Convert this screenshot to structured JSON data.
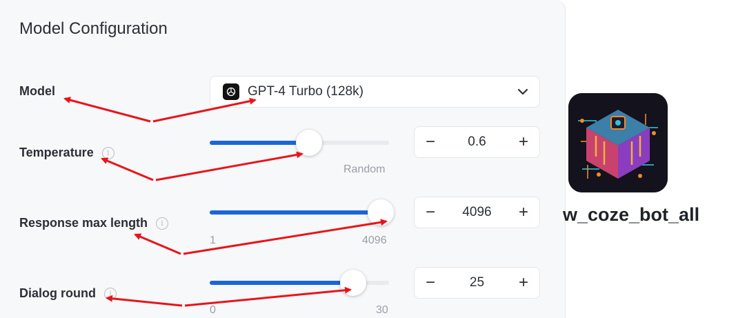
{
  "panel": {
    "title": "Model Configuration"
  },
  "model": {
    "label": "Model",
    "selected": "GPT-4 Turbo (128k)"
  },
  "temperature": {
    "label": "Temperature",
    "value": "0.6",
    "fraction": 0.56,
    "end_label": "Random"
  },
  "response_max_length": {
    "label": "Response max length",
    "value": "4096",
    "fraction": 1.0,
    "min_label": "1",
    "max_label": "4096"
  },
  "dialog_round": {
    "label": "Dialog round",
    "value": "25",
    "fraction": 0.83,
    "min_label": "0",
    "max_label": "30"
  },
  "stepper": {
    "minus": "−",
    "plus": "+"
  },
  "info_glyph": "i",
  "bot": {
    "name": "w_coze_bot_all"
  },
  "colors": {
    "accent": "#1a66d6",
    "annotation_arrow": "#e8141a"
  }
}
